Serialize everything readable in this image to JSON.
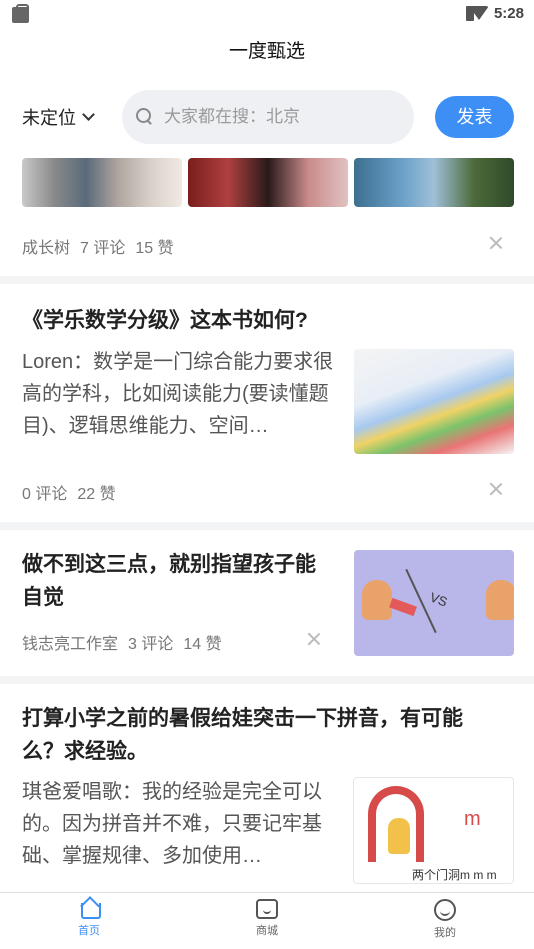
{
  "status_bar": {
    "time": "5:28",
    "icons": [
      "bag-icon",
      "wifi-icon",
      "battery-icon"
    ]
  },
  "header": {
    "title": "一度甄选"
  },
  "toolbar": {
    "location_label": "未定位",
    "search_placeholder": "大家都在搜：北京",
    "publish_label": "发表"
  },
  "feed": {
    "items": [
      {
        "author": "成长树",
        "comments": "7 评论",
        "likes": "15 赞"
      },
      {
        "title": "《学乐数学分级》这本书如何?",
        "excerpt": "Loren：数学是一门综合能力要求很高的学科，比如阅读能力(要读懂题目)、逻辑思维能力、空间…",
        "comments": "0 评论",
        "likes": "22 赞"
      },
      {
        "title": "做不到这三点，就别指望孩子能自觉",
        "author": "钱志亮工作室",
        "comments": "3 评论",
        "likes": "14 赞",
        "thumb_text": "VS"
      },
      {
        "title": "打算小学之前的暑假给娃突击一下拼音，有可能么？求经验。",
        "excerpt": "琪爸爱唱歌：我的经验是完全可以的。因为拼音并不难，只要记牢基础、掌握规律、多加使用…",
        "thumb_letter": "m",
        "thumb_caption": "两个门洞m m m"
      }
    ]
  },
  "tabbar": {
    "tabs": [
      {
        "label": "首页",
        "icon": "home-icon"
      },
      {
        "label": "商城",
        "icon": "shop-icon"
      },
      {
        "label": "我的",
        "icon": "smile-icon"
      }
    ]
  },
  "colors": {
    "accent": "#3d8ff6",
    "separator": "#f3f4f6",
    "thumb_purple": "#b9b6ea"
  }
}
